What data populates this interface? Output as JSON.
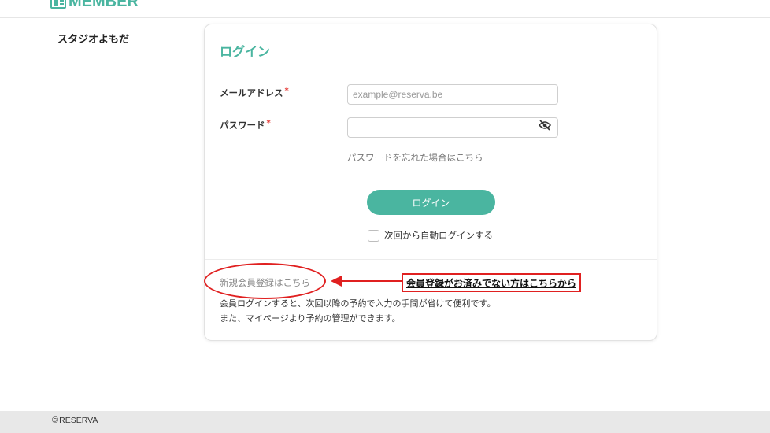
{
  "header": {
    "logo_text": "MEMBER",
    "logo_icon": "member-card-icon",
    "brand_color": "#4ab5a0"
  },
  "sidebar": {
    "store_name": "スタジオよもだ"
  },
  "login": {
    "title": "ログイン",
    "email_label": "メールアドレス",
    "email_placeholder": "example@reserva.be",
    "email_value": "",
    "password_label": "パスワード",
    "password_value": "",
    "required_mark": "*",
    "password_toggle_icon": "eye-off-icon",
    "forgot_password": "パスワードを忘れた場合はこちら",
    "submit_label": "ログイン",
    "auto_login_label": "次回から自動ログインする",
    "auto_login_checked": false
  },
  "register": {
    "link_text": "新規会員登録はこちら",
    "description_line1": "会員ログインすると、次回以降の予約で入力の手間が省けて便利です。",
    "description_line2": "また、マイページより予約の管理ができます。"
  },
  "annotation": {
    "note": "会員登録がお済みでない方はこちらから",
    "color": "#e02020"
  },
  "footer": {
    "copyright_symbol": "©",
    "copyright_text": "RESERVA"
  }
}
